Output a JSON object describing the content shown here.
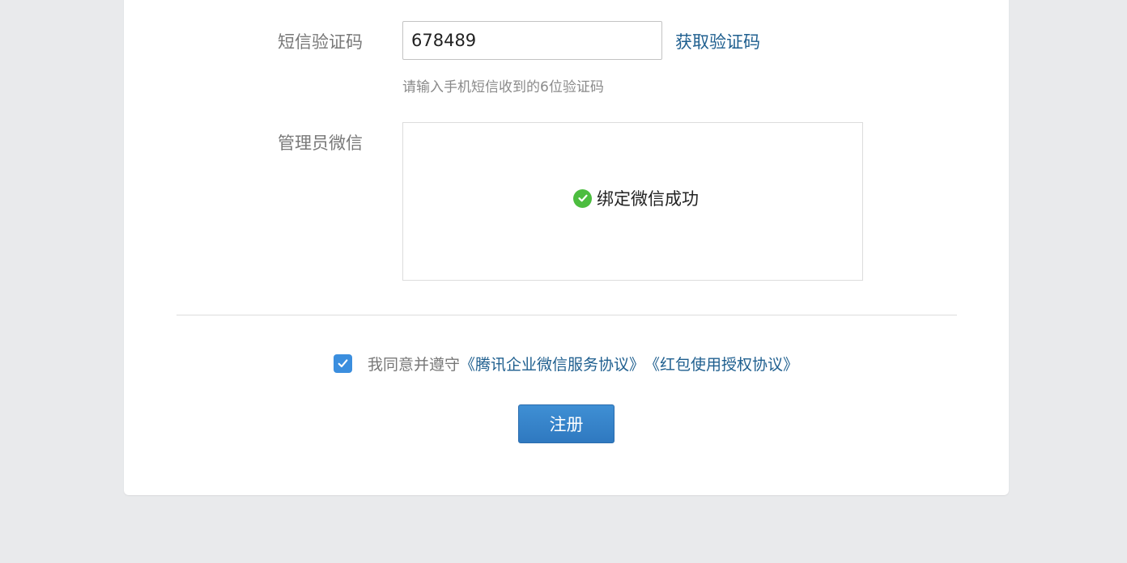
{
  "form": {
    "sms_code": {
      "label": "短信验证码",
      "value": "678489",
      "get_code_label": "获取验证码",
      "hint": "请输入手机短信收到的6位验证码"
    },
    "admin_wechat": {
      "label": "管理员微信",
      "status_text": "绑定微信成功",
      "status_icon": "check-circle-icon"
    },
    "agreement": {
      "checked": true,
      "prefix": "我同意并遵守",
      "link_service": "《腾讯企业微信服务协议》",
      "link_redpacket": "《红包使用授权协议》"
    },
    "submit_label": "注册"
  },
  "colors": {
    "link": "#1f5f8f",
    "primary": "#2f79c0",
    "success": "#4cbd3f",
    "checkbox": "#3b8ede",
    "background": "#e9eaec"
  }
}
